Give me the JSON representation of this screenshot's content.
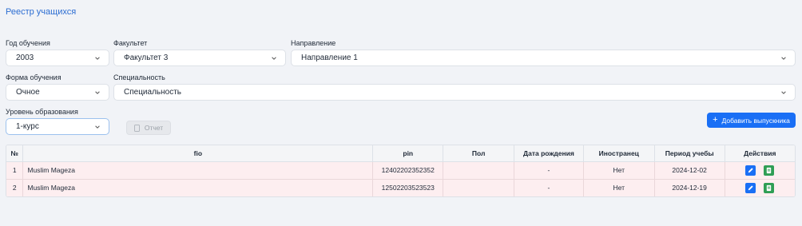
{
  "page": {
    "title": "Реестр учащихся"
  },
  "filters": {
    "year": {
      "label": "Год обучения",
      "value": "2003"
    },
    "faculty": {
      "label": "Факультет",
      "value": "Факультет 3"
    },
    "direction": {
      "label": "Направление",
      "value": "Направление 1"
    },
    "study_form": {
      "label": "Форма обучения",
      "value": "Очное"
    },
    "specialty": {
      "label": "Специальность",
      "value": "Специальность"
    },
    "education_level": {
      "label": "Уровень образования",
      "value": "1-курс"
    }
  },
  "buttons": {
    "report": "Отчет",
    "add_graduate": "Добавить выпускника"
  },
  "table": {
    "headers": [
      "№",
      "fio",
      "pin",
      "Пол",
      "Дата рождения",
      "Иностранец",
      "Период учебы",
      "Действия"
    ],
    "rows": [
      {
        "num": "1",
        "fio": "Muslim Mageza",
        "pin": "12402202352352",
        "gender": "",
        "birth_date": "-",
        "foreigner": "Нет",
        "period": "2024-12-02"
      },
      {
        "num": "2",
        "fio": "Muslim Mageza",
        "pin": "12502203523523",
        "gender": "",
        "birth_date": "-",
        "foreigner": "Нет",
        "period": "2024-12-19"
      }
    ]
  },
  "icons": {
    "dropdown": "chevron-down-icon",
    "report": "document-icon",
    "add": "plus-icon",
    "edit": "pencil-icon",
    "export": "spreadsheet-icon"
  },
  "colors": {
    "accent": "#1a6ff5",
    "title": "#2c6dd2",
    "row_bg": "#fdeef0",
    "export": "#2f9e55"
  }
}
